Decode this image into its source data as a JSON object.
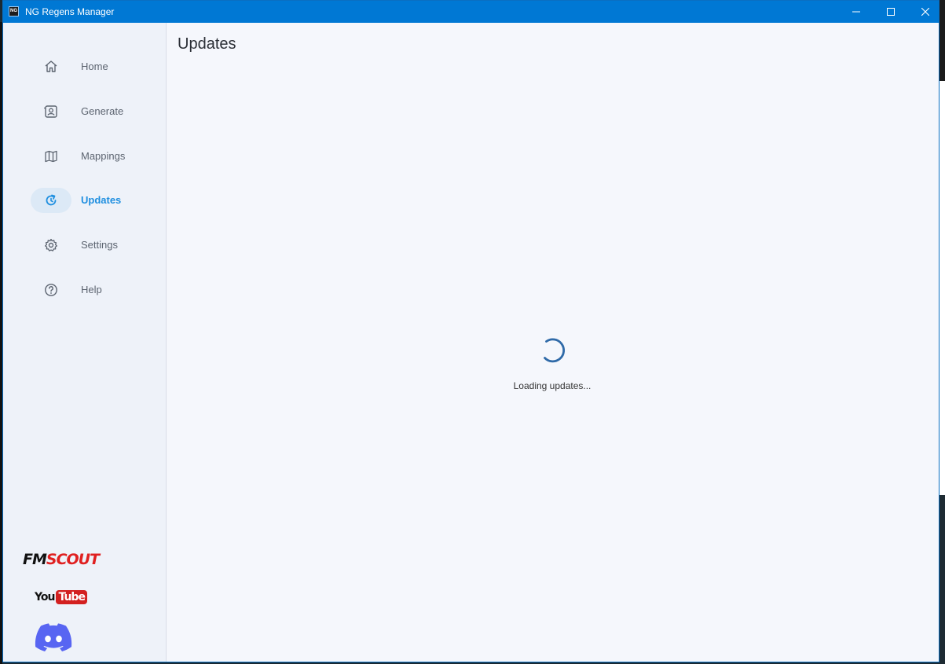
{
  "window": {
    "app_icon_text": "NG",
    "title": "NG Regens Manager",
    "controls": {
      "minimize": "minimize",
      "maximize": "maximize",
      "close": "close"
    }
  },
  "sidebar": {
    "items": [
      {
        "label": "Home",
        "icon": "home-icon",
        "active": false
      },
      {
        "label": "Generate",
        "icon": "id-card-icon",
        "active": false
      },
      {
        "label": "Mappings",
        "icon": "map-icon",
        "active": false
      },
      {
        "label": "Updates",
        "icon": "refresh-icon",
        "active": true
      },
      {
        "label": "Settings",
        "icon": "gear-icon",
        "active": false
      },
      {
        "label": "Help",
        "icon": "help-circle-icon",
        "active": false
      }
    ],
    "links": {
      "fmscout_fm": "FM",
      "fmscout_scout": "SCOUT",
      "youtube_you": "You",
      "youtube_tube": "Tube",
      "discord": "discord-icon"
    }
  },
  "main": {
    "title": "Updates",
    "loading_text": "Loading updates..."
  },
  "colors": {
    "titlebar": "#0078d4",
    "accent": "#1f8fe0",
    "active_pill": "#dce9f6",
    "sidebar_bg": "#eef2f9",
    "content_bg": "#f5f7fc",
    "spinner": "#2f6aa8",
    "discord": "#5865f2"
  }
}
